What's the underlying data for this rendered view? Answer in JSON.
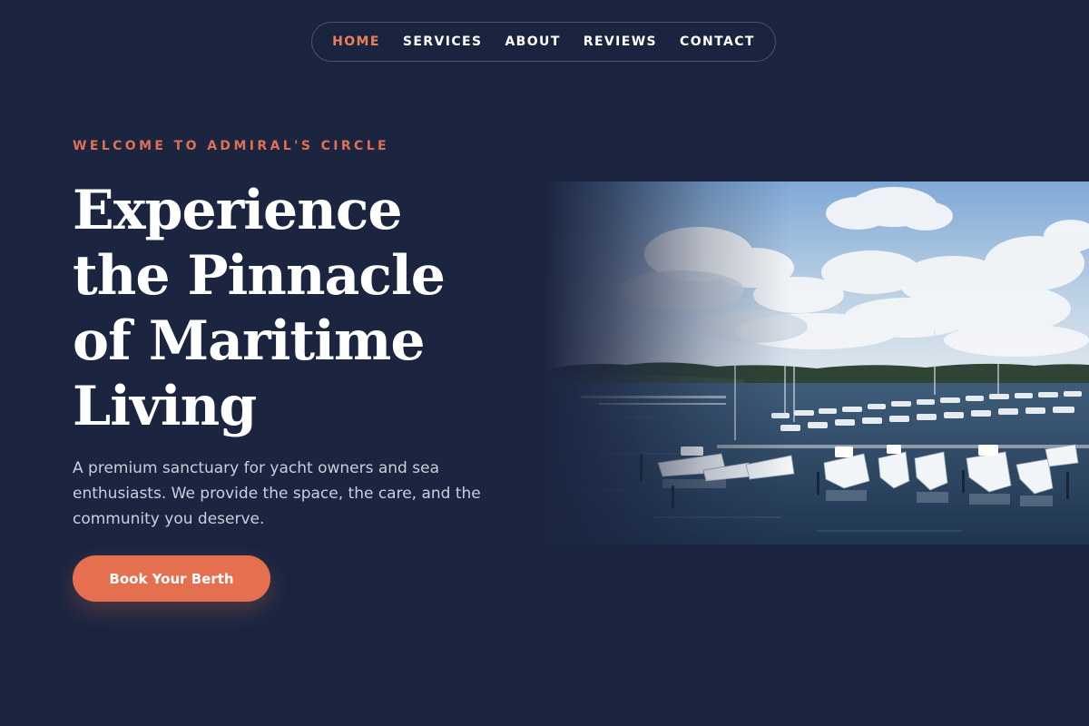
{
  "nav": {
    "items": [
      {
        "label": "HOME",
        "active": true
      },
      {
        "label": "SERVICES",
        "active": false
      },
      {
        "label": "ABOUT",
        "active": false
      },
      {
        "label": "REVIEWS",
        "active": false
      },
      {
        "label": "CONTACT",
        "active": false
      }
    ]
  },
  "hero": {
    "eyebrow": "WELCOME TO ADMIRAL'S CIRCLE",
    "headline": "Experience the Pinnacle of Maritime Living",
    "subtext": "A premium sanctuary for yacht owners and sea enthusiasts. We provide the space, the care, and the community you deserve.",
    "cta_label": "Book Your Berth",
    "image_alt": "Marina with rows of docked yachts under a cloudy sky"
  },
  "colors": {
    "background": "#1b2540",
    "accent": "#e5704f",
    "eyebrow": "#e07055",
    "nav_active": "#e8815a",
    "text": "#ffffff",
    "subtext": "#c9cfdc"
  }
}
